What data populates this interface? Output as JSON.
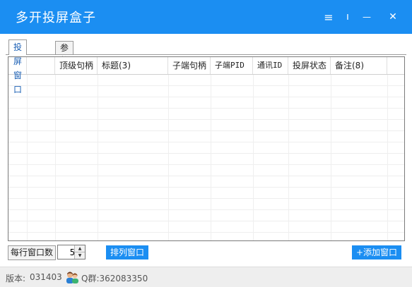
{
  "window": {
    "title": "多开投屏盒子",
    "menu_glyph": "≡",
    "pin_glyph": "ı",
    "minimize_glyph": "—",
    "close_glyph": "✕"
  },
  "tabs": [
    {
      "label": "投屏窗口",
      "active": true
    },
    {
      "label": "参数设置",
      "active": false
    }
  ],
  "grid": {
    "columns": [
      "",
      "",
      "顶级句柄",
      "标题(3)",
      "子端句柄",
      "子端PID",
      "通讯ID",
      "投屏状态",
      "备注(8)",
      ""
    ],
    "rows": []
  },
  "bottom": {
    "per_row_label": "每行窗口数",
    "per_row_value": "5",
    "arrange_label": "排列窗口",
    "add_label": "+添加窗口"
  },
  "status": {
    "version_label": "版本:",
    "version_value": "031403",
    "qq_group": "Q群:362083350"
  },
  "colors": {
    "accent": "#1b8ef2"
  }
}
